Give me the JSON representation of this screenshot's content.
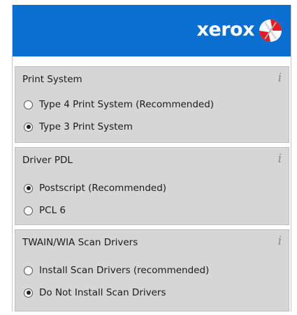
{
  "header": {
    "brand": "xerox",
    "brand_color": "#0a6fd0",
    "logo_icon": "xerox-sphere-logo"
  },
  "sections": [
    {
      "title": "Print System",
      "info_icon": "i",
      "options": [
        {
          "label": "Type 4 Print System (Recommended)",
          "selected": false
        },
        {
          "label": "Type 3 Print System",
          "selected": true
        }
      ]
    },
    {
      "title": "Driver PDL",
      "info_icon": "i",
      "options": [
        {
          "label": "Postscript (Recommended)",
          "selected": true
        },
        {
          "label": "PCL 6",
          "selected": false
        }
      ]
    },
    {
      "title": "TWAIN/WIA Scan Drivers",
      "info_icon": "i",
      "options": [
        {
          "label": "Install Scan Drivers (recommended)",
          "selected": false
        },
        {
          "label": "Do Not Install Scan Drivers",
          "selected": true
        }
      ]
    }
  ]
}
